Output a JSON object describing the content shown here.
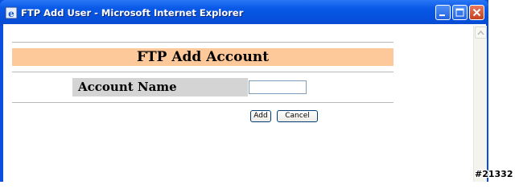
{
  "window": {
    "title": "FTP Add User - Microsoft Internet Explorer",
    "app_icon": "ie-icon",
    "controls": [
      "minimize-icon",
      "maximize-icon",
      "close-icon"
    ]
  },
  "form": {
    "heading": "FTP Add Account",
    "account_name_label": "Account Name",
    "account_name_value": "",
    "add_label": "Add",
    "cancel_label": "Cancel"
  },
  "colors": {
    "titlebar": "#0a5ae8",
    "heading_bg": "#fdc89a",
    "label_bg": "#d4d4d4",
    "close_button": "#c2401f"
  },
  "overlay": {
    "id_label": "#21332"
  }
}
